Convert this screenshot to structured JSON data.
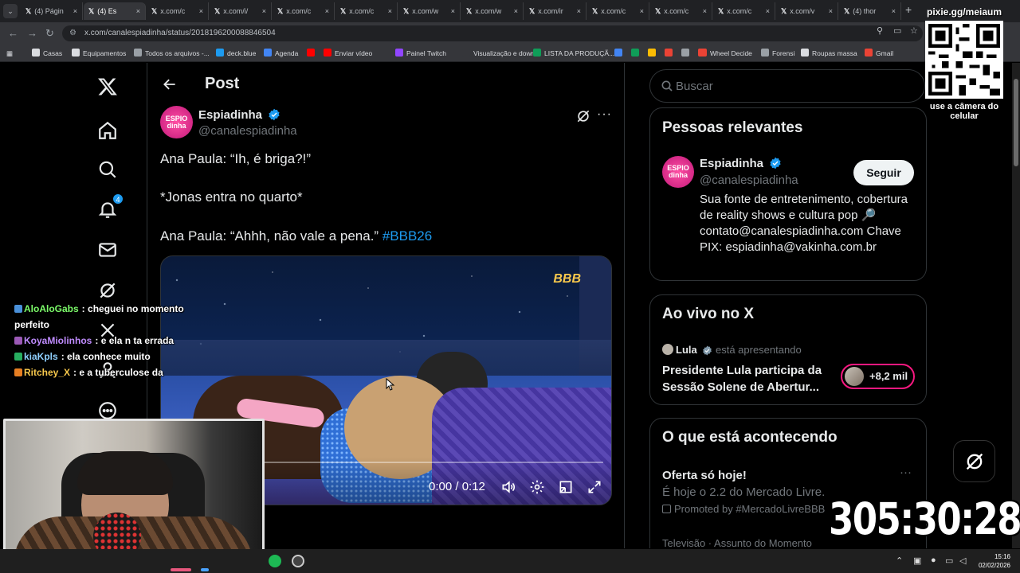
{
  "browser": {
    "tabs": [
      {
        "label": "(4) Págin",
        "active": false
      },
      {
        "label": "(4) Es",
        "active": true
      },
      {
        "label": "x.com/c",
        "active": false
      },
      {
        "label": "x.com/i/",
        "active": false
      },
      {
        "label": "x.com/c",
        "active": false
      },
      {
        "label": "x.com/c",
        "active": false
      },
      {
        "label": "x.com/w",
        "active": false
      },
      {
        "label": "x.com/w",
        "active": false
      },
      {
        "label": "x.com/ir",
        "active": false
      },
      {
        "label": "x.com/c",
        "active": false
      },
      {
        "label": "x.com/c",
        "active": false
      },
      {
        "label": "x.com/c",
        "active": false
      },
      {
        "label": "x.com/v",
        "active": false
      },
      {
        "label": "(4) thor",
        "active": false
      }
    ],
    "url": "x.com/canalespiadinha/status/2018196200088846504",
    "bookmarks": [
      {
        "label": "Casas",
        "color": "#dadce0"
      },
      {
        "label": "Equipamentos",
        "color": "#dadce0"
      },
      {
        "label": "Todos os arquivos -...",
        "color": "#9aa0a6"
      },
      {
        "label": "deck.blue",
        "color": "#1d9bf0"
      },
      {
        "label": "Agenda",
        "color": "#4285f4"
      },
      {
        "label": "",
        "color": "#ff0000"
      },
      {
        "label": "Enviar vídeo",
        "color": "#ff0000"
      },
      {
        "label": "Painel Twitch",
        "color": "#9146ff"
      },
      {
        "label": "Visualização e down...",
        "color": "#35363a"
      },
      {
        "label": "LISTA DA PRODUÇÃ...",
        "color": "#0f9d58"
      },
      {
        "label": "Wheel Decide",
        "color": "#ea4335"
      },
      {
        "label": "Forensi",
        "color": "#9aa0a6"
      },
      {
        "label": "Roupas massa",
        "color": "#dadce0"
      },
      {
        "label": "Gmail",
        "color": "#ea4335"
      }
    ]
  },
  "nav": {
    "notifications_count": "4"
  },
  "post": {
    "header_title": "Post",
    "author_name": "Espiadinha",
    "author_handle": "@canalespiadinha",
    "avatar_text": "ESPIO dinha",
    "lines": [
      "Ana Paula: “Ih, é briga?!”",
      "*Jonas entra no quarto*",
      "Ana Paula: “Ahhh, não vale a pena.”"
    ],
    "hashtag": "#BBB26",
    "video": {
      "logo": "BBB",
      "time": "0:00 / 0:12",
      "progress": 0.0
    }
  },
  "sidebar": {
    "search_placeholder": "Buscar",
    "relevant": {
      "title": "Pessoas relevantes",
      "name": "Espiadinha",
      "handle": "@canalespiadinha",
      "follow_label": "Seguir",
      "bio": "Sua fonte de entretenimento, cobertura de reality shows e cultura pop 🔎 contato@canalespiadinha.com Chave PIX: espiadinha@vakinha.com.br"
    },
    "live": {
      "title": "Ao vivo no X",
      "host": "Lula",
      "host_suffix": "está apresentando",
      "event": "Presidente Lula participa da Sessão Solene de Abertur...",
      "listeners": "+8,2 mil"
    },
    "happening": {
      "title": "O que está acontecendo",
      "item1_title": "Oferta só hoje!",
      "item1_sub": "É hoje o 2.2 do Mercado Livre.",
      "item1_promo": "Promoted by #MercadoLivreBBB",
      "item2_sub": "Televisão · Assunto do Momento"
    }
  },
  "overlay": {
    "chat": [
      {
        "user": "AloAloGabs",
        "user_color": "#7cfc6a",
        "text": "cheguei no momento perfeito"
      },
      {
        "user": "KoyaMiolinhos",
        "user_color": "#c08cff",
        "text": "e ela n ta errada"
      },
      {
        "user": "kiaKpls",
        "user_color": "#8fd0ff",
        "text": "ela conhece muito"
      },
      {
        "user": "Ritchey_X",
        "user_color": "#f7c84c",
        "text": "e a tuberculose da"
      }
    ],
    "qr_url": "pixie.gg/meiaum",
    "qr_caption": "use a câmera do celular",
    "timer": "305:30:28"
  },
  "taskbar": {
    "time": "15:16",
    "date": "02/02/2026"
  }
}
